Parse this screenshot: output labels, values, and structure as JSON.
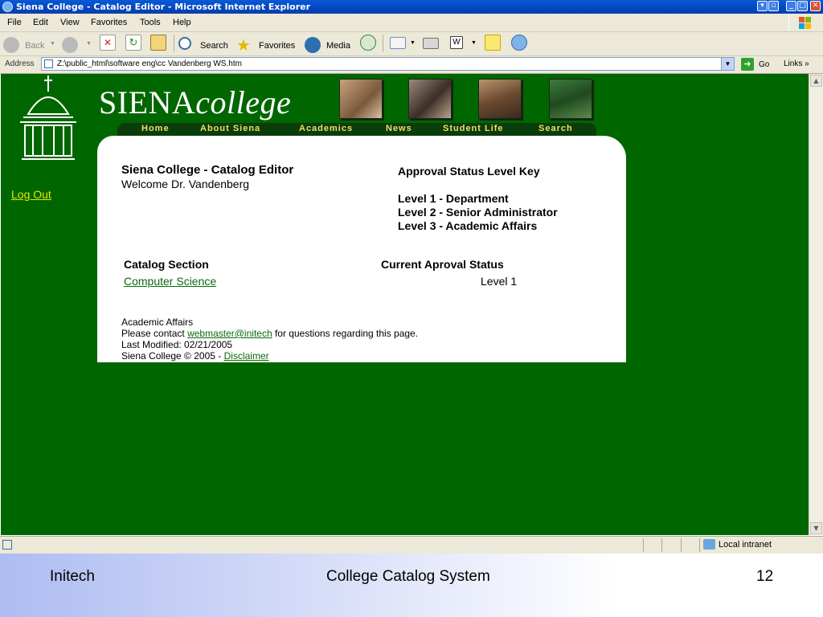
{
  "window": {
    "title": "Siena College - Catalog Editor - Microsoft Internet Explorer",
    "buttons": {
      "minimize": "_",
      "maximize": "□",
      "close": "✕"
    }
  },
  "menu": [
    "File",
    "Edit",
    "View",
    "Favorites",
    "Tools",
    "Help"
  ],
  "toolbar": {
    "back": "Back",
    "search": "Search",
    "favorites": "Favorites",
    "media": "Media"
  },
  "address": {
    "label": "Address",
    "value": "Z:\\public_html\\software eng\\cc Vandenberg WS.htm",
    "go": "Go",
    "links": "Links"
  },
  "site": {
    "brand_main": "SIENA",
    "brand_italic": "college",
    "logout": "Log Out",
    "nav": [
      "Home",
      "About Siena",
      "Academics",
      "News",
      "Student Life",
      "Search"
    ]
  },
  "editor": {
    "heading": "Siena College - Catalog Editor",
    "welcome": "Welcome Dr. Vandenberg",
    "key_title": "Approval Status Level Key",
    "levels": [
      "Level 1 - Department",
      "Level 2 - Senior Administrator",
      "Level 3 - Academic Affairs"
    ],
    "col_section": "Catalog Section",
    "col_status": "Current Aproval Status",
    "row_section": "Computer Science",
    "row_status": "Level 1"
  },
  "footer": {
    "dept": "Academic Affairs",
    "contact_pre": "Please contact",
    "contact_link": "webmaster@initech",
    "contact_post": "for questions regarding this page.",
    "modified": "Last Modified: 02/21/2005",
    "copyright": "Siena College © 2005 -",
    "disclaimer": "Disclaimer"
  },
  "statusbar": {
    "zone": "Local intranet"
  },
  "slide": {
    "left": "Initech",
    "center": "College Catalog System",
    "page": "12"
  },
  "colors": {
    "page_bg": "#006600",
    "nav_text": "#f3df6a",
    "link": "#0a6a0a",
    "logout": "#e6e600"
  }
}
